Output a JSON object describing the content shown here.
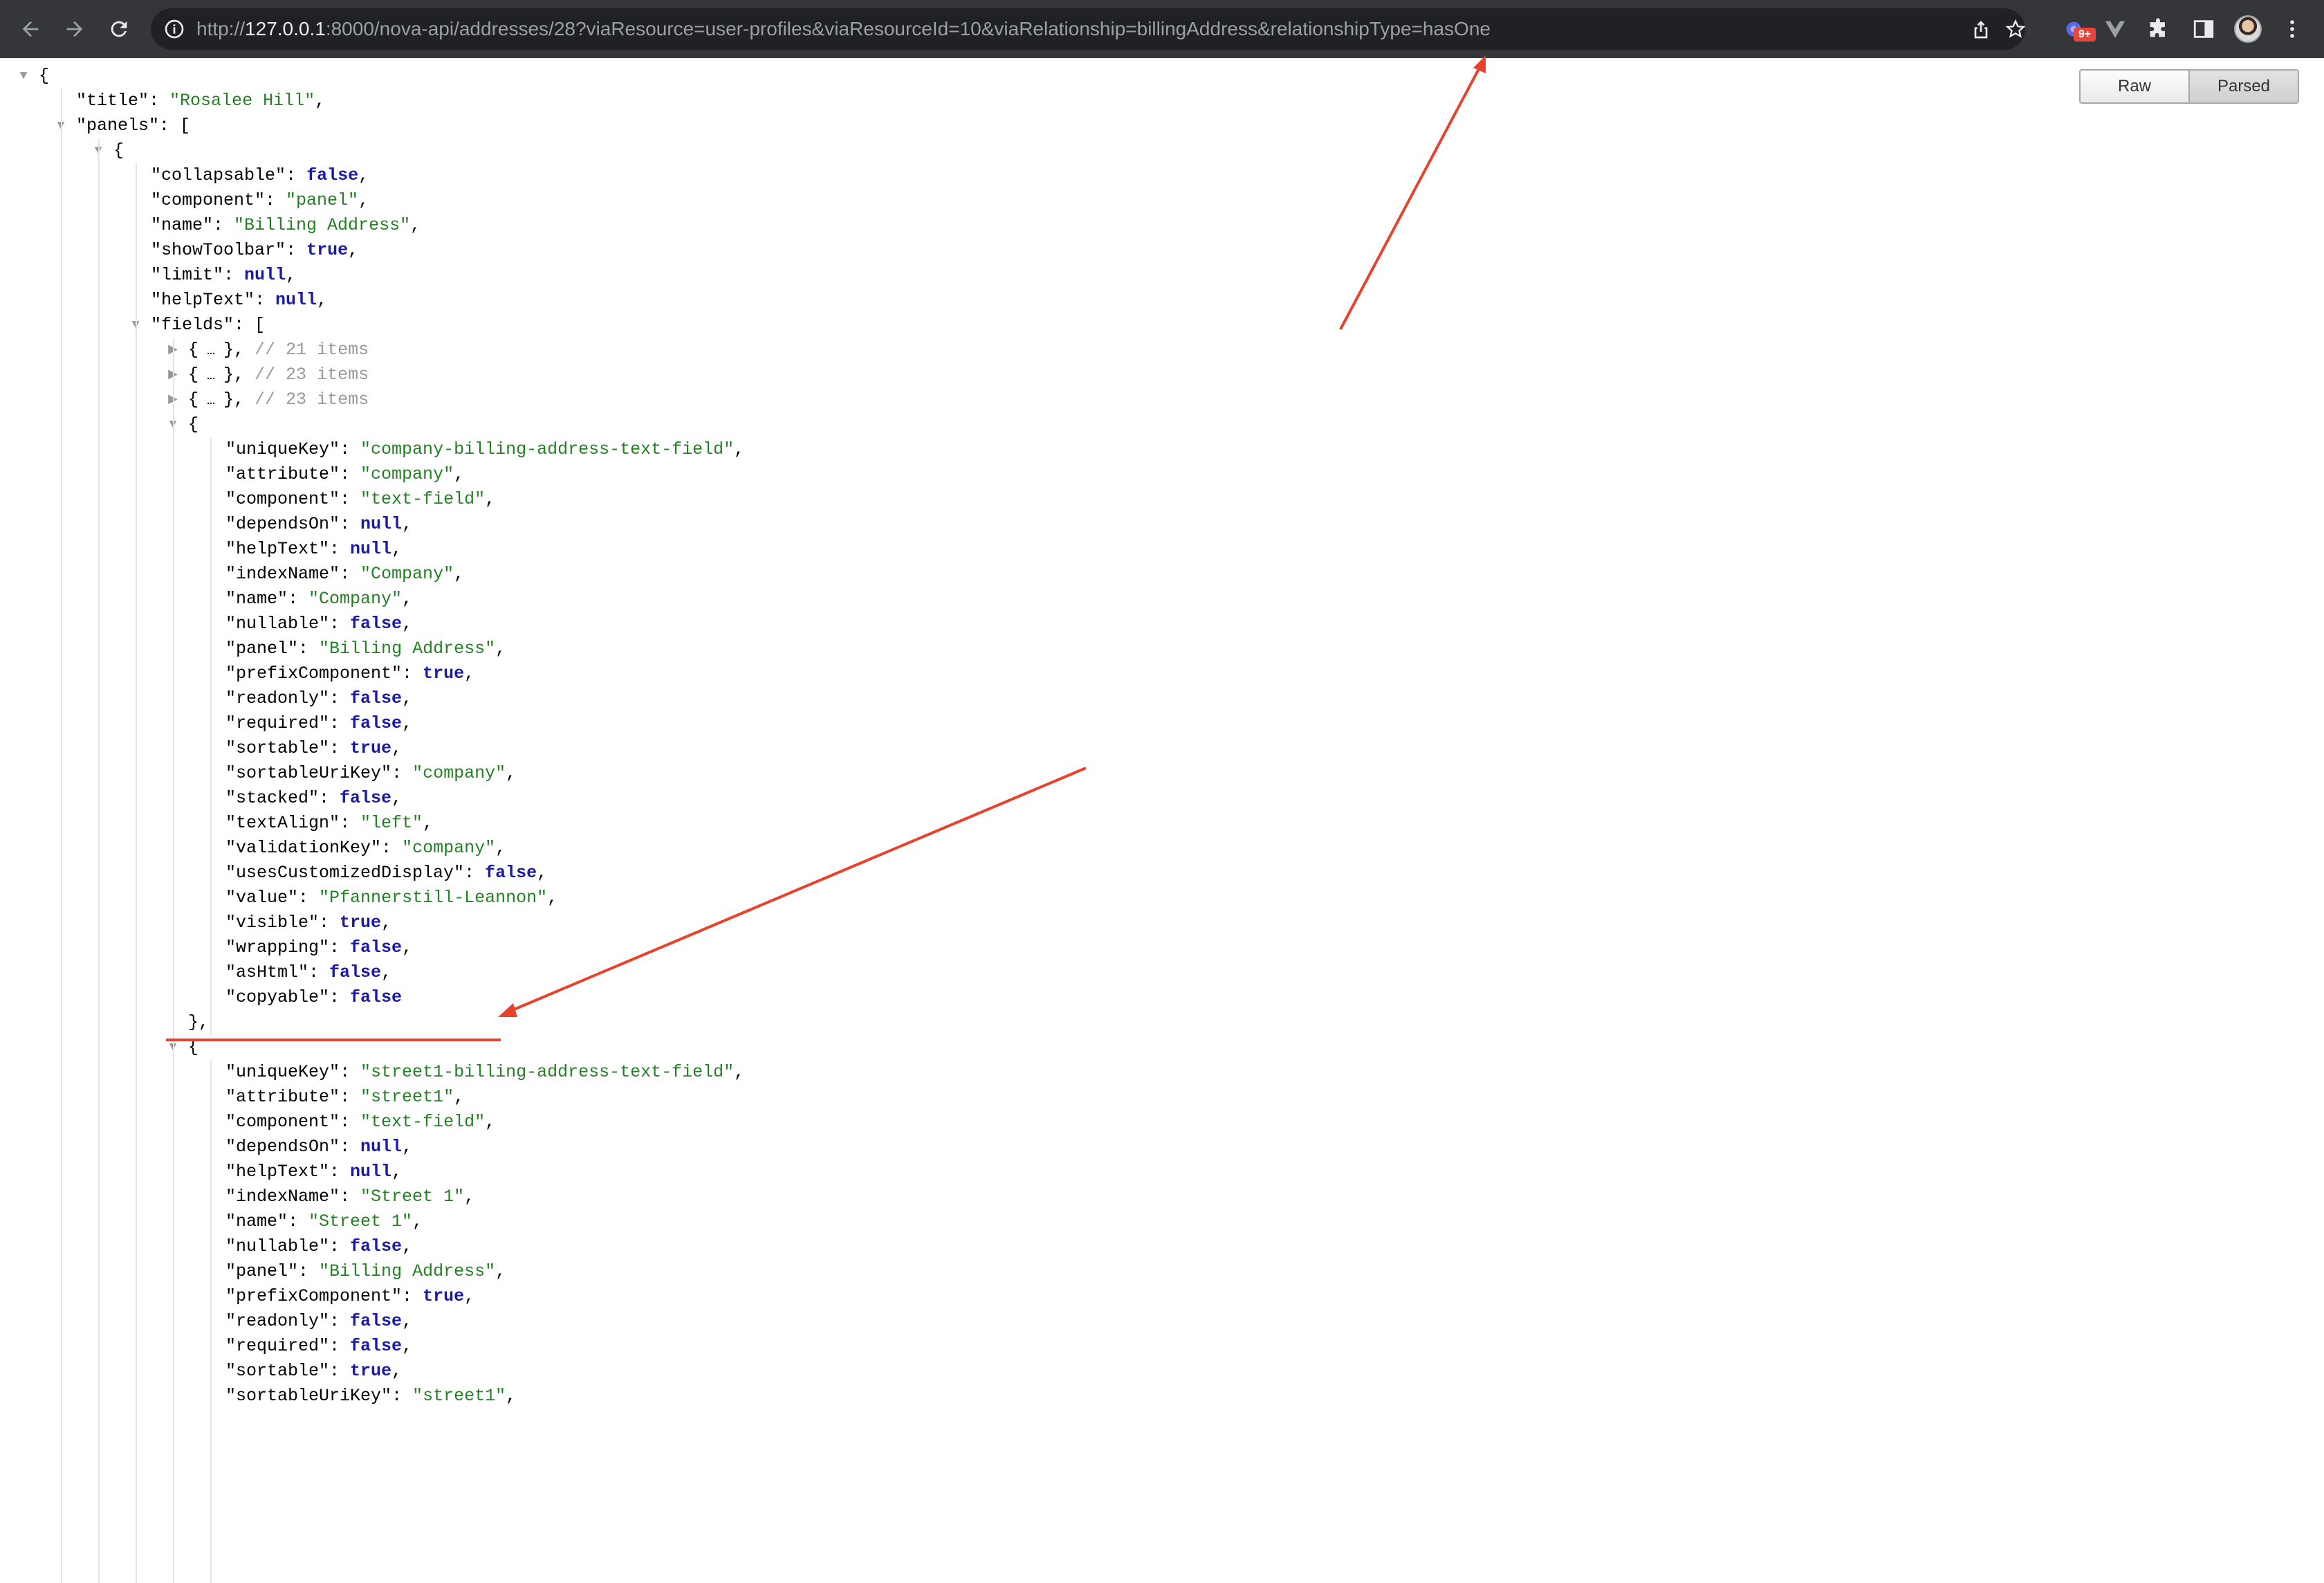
{
  "browser": {
    "url_scheme": "http://",
    "url_host": "127.0.0.1",
    "url_rest": ":8000/nova-api/addresses/28?viaResource=user-profiles&viaResourceId=10&viaRelationship=billingAddress&relationshipType=hasOne",
    "extension_badge": "9+"
  },
  "viewer": {
    "raw_label": "Raw",
    "parsed_label": "Parsed"
  },
  "json_root": {
    "title_key": "\"title\"",
    "title_value": "\"Rosalee Hill\"",
    "panels_key": "\"panels\""
  },
  "panel": {
    "props": [
      {
        "key": "\"collapsable\"",
        "value": "false",
        "type": "kw"
      },
      {
        "key": "\"component\"",
        "value": "\"panel\"",
        "type": "str"
      },
      {
        "key": "\"name\"",
        "value": "\"Billing Address\"",
        "type": "str"
      },
      {
        "key": "\"showToolbar\"",
        "value": "true",
        "type": "kw"
      },
      {
        "key": "\"limit\"",
        "value": "null",
        "type": "kw"
      },
      {
        "key": "\"helpText\"",
        "value": "null",
        "type": "kw"
      }
    ],
    "fields_key": "\"fields\"",
    "collapsed": [
      {
        "comment": "// 21 items"
      },
      {
        "comment": "// 23 items"
      },
      {
        "comment": "// 23 items"
      }
    ]
  },
  "field_company": [
    {
      "key": "\"uniqueKey\"",
      "value": "\"company-billing-address-text-field\"",
      "type": "str"
    },
    {
      "key": "\"attribute\"",
      "value": "\"company\"",
      "type": "str"
    },
    {
      "key": "\"component\"",
      "value": "\"text-field\"",
      "type": "str"
    },
    {
      "key": "\"dependsOn\"",
      "value": "null",
      "type": "kw"
    },
    {
      "key": "\"helpText\"",
      "value": "null",
      "type": "kw"
    },
    {
      "key": "\"indexName\"",
      "value": "\"Company\"",
      "type": "str"
    },
    {
      "key": "\"name\"",
      "value": "\"Company\"",
      "type": "str"
    },
    {
      "key": "\"nullable\"",
      "value": "false",
      "type": "kw"
    },
    {
      "key": "\"panel\"",
      "value": "\"Billing Address\"",
      "type": "str"
    },
    {
      "key": "\"prefixComponent\"",
      "value": "true",
      "type": "kw"
    },
    {
      "key": "\"readonly\"",
      "value": "false",
      "type": "kw"
    },
    {
      "key": "\"required\"",
      "value": "false",
      "type": "kw"
    },
    {
      "key": "\"sortable\"",
      "value": "true",
      "type": "kw"
    },
    {
      "key": "\"sortableUriKey\"",
      "value": "\"company\"",
      "type": "str"
    },
    {
      "key": "\"stacked\"",
      "value": "false",
      "type": "kw"
    },
    {
      "key": "\"textAlign\"",
      "value": "\"left\"",
      "type": "str"
    },
    {
      "key": "\"validationKey\"",
      "value": "\"company\"",
      "type": "str"
    },
    {
      "key": "\"usesCustomizedDisplay\"",
      "value": "false",
      "type": "kw"
    },
    {
      "key": "\"value\"",
      "value": "\"Pfannerstill-Leannon\"",
      "type": "str"
    },
    {
      "key": "\"visible\"",
      "value": "true",
      "type": "kw"
    },
    {
      "key": "\"wrapping\"",
      "value": "false",
      "type": "kw"
    },
    {
      "key": "\"asHtml\"",
      "value": "false",
      "type": "kw"
    },
    {
      "key": "\"copyable\"",
      "value": "false",
      "type": "kw",
      "last": true
    }
  ],
  "field_street1": [
    {
      "key": "\"uniqueKey\"",
      "value": "\"street1-billing-address-text-field\"",
      "type": "str"
    },
    {
      "key": "\"attribute\"",
      "value": "\"street1\"",
      "type": "str"
    },
    {
      "key": "\"component\"",
      "value": "\"text-field\"",
      "type": "str"
    },
    {
      "key": "\"dependsOn\"",
      "value": "null",
      "type": "kw"
    },
    {
      "key": "\"helpText\"",
      "value": "null",
      "type": "kw"
    },
    {
      "key": "\"indexName\"",
      "value": "\"Street 1\"",
      "type": "str"
    },
    {
      "key": "\"name\"",
      "value": "\"Street 1\"",
      "type": "str"
    },
    {
      "key": "\"nullable\"",
      "value": "false",
      "type": "kw"
    },
    {
      "key": "\"panel\"",
      "value": "\"Billing Address\"",
      "type": "str"
    },
    {
      "key": "\"prefixComponent\"",
      "value": "true",
      "type": "kw"
    },
    {
      "key": "\"readonly\"",
      "value": "false",
      "type": "kw"
    },
    {
      "key": "\"required\"",
      "value": "false",
      "type": "kw"
    },
    {
      "key": "\"sortable\"",
      "value": "true",
      "type": "kw"
    },
    {
      "key": "\"sortableUriKey\"",
      "value": "\"street1\"",
      "type": "str"
    }
  ],
  "colors": {
    "toolbar": "#35363a",
    "omnibox": "#202124",
    "string": "#248024",
    "keyword": "#1a1aa6",
    "comment": "#999999",
    "annotation": "#e8412c"
  }
}
